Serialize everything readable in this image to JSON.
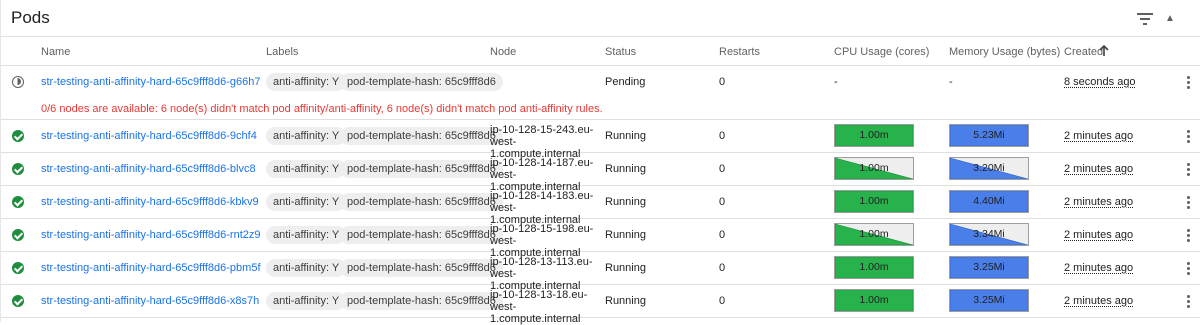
{
  "title": "Pods",
  "columns": {
    "name": "Name",
    "labels": "Labels",
    "node": "Node",
    "status": "Status",
    "restarts": "Restarts",
    "cpu": "CPU Usage (cores)",
    "memory": "Memory Usage (bytes)",
    "created": "Created"
  },
  "colors": {
    "cpu_fill": "#27b24c",
    "mem_fill": "#4a7ee8",
    "link": "#1a73e8",
    "error": "#e53935"
  },
  "pending_row": {
    "name": "str-testing-anti-affinity-hard-65c9fff8d6-g66h7",
    "labels": [
      "anti-affinity: Y",
      "pod-template-hash: 65c9fff8d6"
    ],
    "node": "",
    "status": "Pending",
    "restarts": "0",
    "cpu": "-",
    "memory": "-",
    "created": "8 seconds ago",
    "message": "0/6 nodes are available: 6 node(s) didn't match pod affinity/anti-affinity, 6 node(s) didn't match pod anti-affinity rules."
  },
  "rows": [
    {
      "name": "str-testing-anti-affinity-hard-65c9fff8d6-9chf4",
      "labels": [
        "anti-affinity: Y",
        "pod-template-hash: 65c9fff8d6"
      ],
      "node_line1": "ip-10-128-15-243.eu-west-",
      "node_line2": "1.compute.internal",
      "status": "Running",
      "restarts": "0",
      "cpu": "1.00m",
      "cpu_shape": "full",
      "memory": "5.23Mi",
      "mem_shape": "full",
      "created": "2 minutes ago"
    },
    {
      "name": "str-testing-anti-affinity-hard-65c9fff8d6-blvc8",
      "labels": [
        "anti-affinity: Y",
        "pod-template-hash: 65c9fff8d6"
      ],
      "node_line1": "ip-10-128-14-187.eu-west-",
      "node_line2": "1.compute.internal",
      "status": "Running",
      "restarts": "0",
      "cpu": "1.00m",
      "cpu_shape": "declining",
      "memory": "3.20Mi",
      "mem_shape": "declining",
      "created": "2 minutes ago"
    },
    {
      "name": "str-testing-anti-affinity-hard-65c9fff8d6-kbkv9",
      "labels": [
        "anti-affinity: Y",
        "pod-template-hash: 65c9fff8d6"
      ],
      "node_line1": "ip-10-128-14-183.eu-west-",
      "node_line2": "1.compute.internal",
      "status": "Running",
      "restarts": "0",
      "cpu": "1.00m",
      "cpu_shape": "full",
      "memory": "4.40Mi",
      "mem_shape": "full",
      "created": "2 minutes ago"
    },
    {
      "name": "str-testing-anti-affinity-hard-65c9fff8d6-rnt2z9",
      "labels": [
        "anti-affinity: Y",
        "pod-template-hash: 65c9fff8d6"
      ],
      "node_line1": "ip-10-128-15-198.eu-west-",
      "node_line2": "1.compute.internal",
      "status": "Running",
      "restarts": "0",
      "cpu": "1.00m",
      "cpu_shape": "declining",
      "memory": "3.34Mi",
      "mem_shape": "declining",
      "created": "2 minutes ago"
    },
    {
      "name": "str-testing-anti-affinity-hard-65c9fff8d6-pbm5f",
      "labels": [
        "anti-affinity: Y",
        "pod-template-hash: 65c9fff8d6"
      ],
      "node_line1": "ip-10-128-13-113.eu-west-",
      "node_line2": "1.compute.internal",
      "status": "Running",
      "restarts": "0",
      "cpu": "1.00m",
      "cpu_shape": "full",
      "memory": "3.25Mi",
      "mem_shape": "full",
      "created": "2 minutes ago"
    },
    {
      "name": "str-testing-anti-affinity-hard-65c9fff8d6-x8s7h",
      "labels": [
        "anti-affinity: Y",
        "pod-template-hash: 65c9fff8d6"
      ],
      "node_line1": "ip-10-128-13-18.eu-west-",
      "node_line2": "1.compute.internal",
      "status": "Running",
      "restarts": "0",
      "cpu": "1.00m",
      "cpu_shape": "full",
      "memory": "3.25Mi",
      "mem_shape": "full",
      "created": "2 minutes ago"
    }
  ]
}
